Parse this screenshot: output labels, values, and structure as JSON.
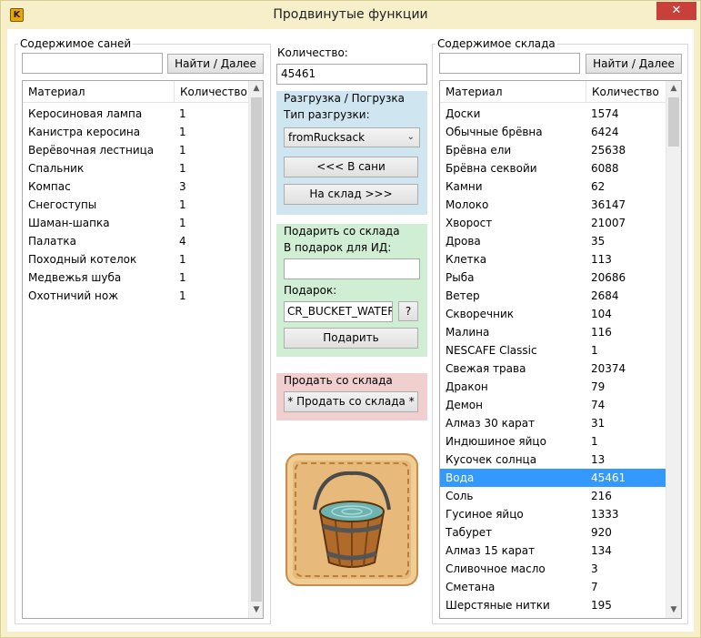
{
  "window": {
    "title": "Продвинутые функции",
    "icon_letter": "K",
    "close_glyph": "✕"
  },
  "sled": {
    "group_label": "Содержимое саней",
    "search_value": "",
    "find_button": "Найти / Далее",
    "columns": [
      "Материал",
      "Количество"
    ],
    "rows": [
      {
        "name": "Керосиновая лампа",
        "qty": "1"
      },
      {
        "name": "Канистра керосина",
        "qty": "1"
      },
      {
        "name": "Верёвочная лестница",
        "qty": "1"
      },
      {
        "name": "Спальник",
        "qty": "1"
      },
      {
        "name": "Компас",
        "qty": "3"
      },
      {
        "name": "Снегоступы",
        "qty": "1"
      },
      {
        "name": "Шаман-шапка",
        "qty": "1"
      },
      {
        "name": "Палатка",
        "qty": "4"
      },
      {
        "name": "Походный котелок",
        "qty": "1"
      },
      {
        "name": "Медвежья шуба",
        "qty": "1"
      },
      {
        "name": "Охотничий нож",
        "qty": "1"
      }
    ]
  },
  "center": {
    "quantity_label": "Количество:",
    "quantity_value": "45461",
    "unload": {
      "title": "Разгрузка / Погрузка",
      "type_label": "Тип разгрузки:",
      "type_value": "fromRucksack",
      "to_sled_button": "<<< В сани",
      "to_warehouse_button": "На склад >>>"
    },
    "gift": {
      "title": "Подарить со склада",
      "recipient_label": "В подарок для ИД:",
      "recipient_value": "",
      "gift_label": "Подарок:",
      "gift_value": "CR_BUCKET_WATER",
      "help_button": "?",
      "gift_button": "Подарить"
    },
    "sell": {
      "title": "Продать со склада",
      "sell_button": "* Продать со склада *"
    },
    "item_image": "water-bucket-icon"
  },
  "warehouse": {
    "group_label": "Содержимое склада",
    "search_value": "",
    "find_button": "Найти / Далее",
    "columns": [
      "Материал",
      "Количество"
    ],
    "selected_index": 21,
    "rows": [
      {
        "name": "Доски",
        "qty": "1574"
      },
      {
        "name": "Обычные брёвна",
        "qty": "6424"
      },
      {
        "name": "Брёвна ели",
        "qty": "25638"
      },
      {
        "name": "Брёвна секвойи",
        "qty": "6088"
      },
      {
        "name": "Камни",
        "qty": "62"
      },
      {
        "name": "Молоко",
        "qty": "36147"
      },
      {
        "name": "Хворост",
        "qty": "21007"
      },
      {
        "name": "Дрова",
        "qty": "35"
      },
      {
        "name": "Клетка",
        "qty": "113"
      },
      {
        "name": "Рыба",
        "qty": "20686"
      },
      {
        "name": "Ветер",
        "qty": "2684"
      },
      {
        "name": "Скворечник",
        "qty": "104"
      },
      {
        "name": "Малина",
        "qty": "116"
      },
      {
        "name": "NESCAFE Classic",
        "qty": "1"
      },
      {
        "name": "Свежая трава",
        "qty": "20374"
      },
      {
        "name": "Дракон",
        "qty": "79"
      },
      {
        "name": "Демон",
        "qty": "74"
      },
      {
        "name": "Алмаз 30 карат",
        "qty": "31"
      },
      {
        "name": "Индюшиное яйцо",
        "qty": "1"
      },
      {
        "name": "Кусочек солнца",
        "qty": "13"
      },
      {
        "name": "Вода",
        "qty": "45461"
      },
      {
        "name": "Соль",
        "qty": "216"
      },
      {
        "name": "Гусиное яйцо",
        "qty": "1333"
      },
      {
        "name": "Табурет",
        "qty": "920"
      },
      {
        "name": "Алмаз 15 карат",
        "qty": "134"
      },
      {
        "name": "Сливочное масло",
        "qty": "3"
      },
      {
        "name": "Сметана",
        "qty": "7"
      },
      {
        "name": "Шерстяные нитки",
        "qty": "195"
      }
    ]
  },
  "colors": {
    "frame": "#f6efc9",
    "close": "#c7413a",
    "unload_panel": "#cfe6f1",
    "gift_panel": "#cfeed3",
    "sell_panel": "#f2cfcf",
    "selection": "#3399ff"
  }
}
